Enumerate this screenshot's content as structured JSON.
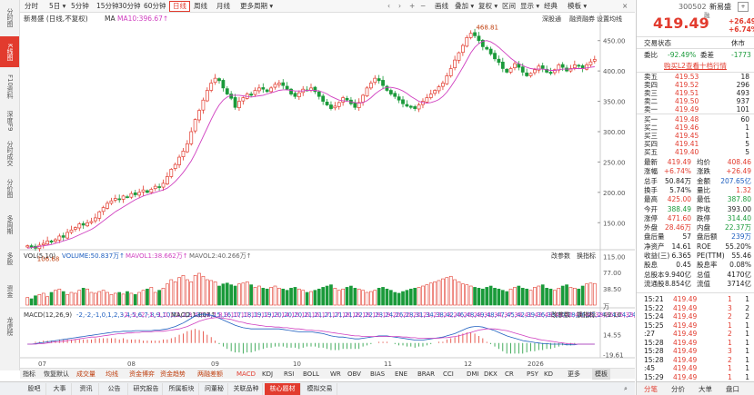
{
  "left_nav": [
    {
      "label": "分时图",
      "active": false
    },
    {
      "label": "K线图",
      "active": true
    },
    {
      "label": "F10资料",
      "active": false
    },
    {
      "label": "深度F9",
      "active": false
    },
    {
      "label": "分时成交",
      "active": false
    },
    {
      "label": "分价图",
      "active": false
    },
    {
      "label": "多周期",
      "active": false
    },
    {
      "label": "多股",
      "active": false
    },
    {
      "label": "资金",
      "active": false
    },
    {
      "label": "龙虎榜",
      "active": false
    }
  ],
  "toolbar": {
    "items": [
      {
        "label": "分时",
        "active": false
      },
      {
        "label": "5日 ▾",
        "active": false
      },
      {
        "label": "5分钟",
        "active": false
      },
      {
        "label": "15分钟",
        "active": false
      },
      {
        "label": "30分钟",
        "active": false
      },
      {
        "label": "60分钟",
        "active": false
      },
      {
        "label": "日线",
        "active": true
      },
      {
        "label": "周线",
        "active": false
      },
      {
        "label": "月线",
        "active": false
      },
      {
        "label": "更多周期 ▾",
        "active": false
      }
    ],
    "right_items": [
      "画线",
      "叠加 ▾",
      "复权 ▾",
      "区间",
      "显示 ▾",
      "经典",
      "模板 ▾"
    ]
  },
  "chart_header": {
    "title": "新易盛 (日线,不复权)",
    "ma_label": "MA",
    "ma10": "MA10:396.67↑",
    "links": [
      "深股通",
      "融资融券",
      "设置均线"
    ]
  },
  "chart_data": [
    {
      "type": "candlestick",
      "title": "新易盛 (日线,不复权)",
      "y_ticks": [
        "450.00",
        "400.00",
        "350.00",
        "300.00",
        "250.00",
        "200.00",
        "150.00"
      ],
      "y_range": [
        110,
        478
      ],
      "x_ticks": [
        "07",
        "08",
        "09",
        "10",
        "11",
        "12",
        "2026"
      ],
      "annotations": [
        {
          "label": "468.81",
          "type": "high"
        },
        {
          "label": "106.68",
          "type": "low"
        }
      ],
      "ma10_label": "MA10:396.67↑",
      "closes": [
        112,
        110,
        108,
        113,
        116,
        120,
        118,
        122,
        128,
        126,
        134,
        138,
        142,
        148,
        146,
        150,
        152,
        158,
        168,
        175,
        182,
        186,
        190,
        188,
        194,
        192,
        198,
        196,
        200,
        204,
        200,
        205,
        210,
        208,
        215,
        226,
        238,
        246,
        258,
        268,
        280,
        300,
        320,
        335,
        352,
        368,
        380,
        388,
        384,
        372,
        362,
        355,
        340,
        350,
        356,
        362,
        360,
        368,
        372,
        370,
        366,
        372,
        378,
        380,
        376,
        370,
        362,
        358,
        364,
        370,
        368,
        372,
        366,
        358,
        350,
        344,
        338,
        342,
        348,
        356,
        352,
        346,
        340,
        348,
        360,
        372,
        380,
        388,
        384,
        376,
        368,
        362,
        358,
        352,
        346,
        342,
        340,
        338,
        344,
        350,
        356,
        362,
        368,
        374,
        380,
        392,
        404,
        418,
        430,
        442,
        455,
        462,
        458,
        450,
        440,
        436,
        428,
        420,
        414,
        404,
        398,
        404,
        412,
        406,
        398,
        392,
        396,
        402,
        408,
        404,
        398,
        396,
        402,
        410,
        406,
        400,
        404,
        410,
        408,
        404,
        410,
        415,
        419
      ],
      "ma10": [
        108,
        109,
        110,
        111,
        112,
        113,
        114,
        116,
        118,
        120,
        122,
        124,
        127,
        130,
        133,
        136,
        139,
        143,
        148,
        153,
        158,
        163,
        168,
        172,
        176,
        180,
        184,
        188,
        191,
        194,
        196,
        198,
        200,
        202,
        204,
        207,
        212,
        218,
        225,
        233,
        242,
        252,
        264,
        278,
        292,
        306,
        320,
        333,
        344,
        352,
        357,
        360,
        360,
        360,
        359,
        358,
        357,
        358,
        359,
        360,
        362,
        364,
        366,
        368,
        369,
        369,
        368,
        367,
        367,
        367,
        368,
        368,
        368,
        367,
        365,
        362,
        358,
        355,
        352,
        351,
        350,
        349,
        348,
        347,
        348,
        351,
        356,
        362,
        367,
        371,
        373,
        373,
        372,
        370,
        367,
        363,
        358,
        354,
        350,
        348,
        347,
        348,
        350,
        353,
        358,
        365,
        374,
        384,
        395,
        406,
        418,
        430,
        439,
        445,
        449,
        450,
        448,
        444,
        439,
        433,
        427,
        421,
        416,
        412,
        409,
        406,
        404,
        403,
        403,
        403,
        402,
        401,
        401,
        402,
        403,
        403,
        403,
        404,
        404,
        404,
        405,
        406,
        407
      ],
      "volume": {
        "label": "VOL(5,10)",
        "volume": "VOLUME:50.837万↑",
        "mavol1": "MAVOL1:38.662万↑",
        "mavol2": "MAVOL2:40.266万↑",
        "y_ticks": [
          "115.00",
          "77.00",
          "38.50"
        ],
        "y_range": [
          0,
          120
        ],
        "values": [
          18,
          15,
          22,
          25,
          28,
          20,
          30,
          35,
          38,
          32,
          25,
          30,
          28,
          35,
          40,
          38,
          30,
          28,
          32,
          35,
          30,
          25,
          28,
          30,
          26,
          32,
          28,
          25,
          30,
          35,
          38,
          42,
          30,
          35,
          40,
          50,
          60,
          55,
          65,
          70,
          60,
          55,
          70,
          75,
          68,
          60,
          58,
          55,
          45,
          50,
          52,
          48,
          45,
          50,
          52,
          55,
          48,
          42,
          45,
          40,
          38,
          42,
          45,
          40,
          38,
          35,
          40,
          42,
          38,
          35,
          30,
          32,
          35,
          38,
          42,
          45,
          48,
          40,
          35,
          38,
          42,
          45,
          40,
          38,
          35,
          30,
          32,
          35,
          40,
          42,
          38,
          35,
          30,
          28,
          32,
          35,
          38,
          40,
          42,
          45,
          48,
          52,
          55,
          58,
          62,
          65,
          68,
          60,
          55,
          50,
          48,
          45,
          42,
          40,
          38,
          42,
          45,
          40,
          38,
          35,
          32,
          38,
          42,
          45,
          40,
          38,
          35,
          42,
          45,
          48,
          40,
          38,
          35,
          40,
          45,
          48,
          42,
          40,
          38,
          45,
          50,
          52,
          51
        ]
      },
      "macd": {
        "label": "MACD(12,26,9)",
        "dif": [
          -2,
          -2,
          -1,
          0,
          1,
          2,
          3,
          4,
          5,
          6,
          7,
          8,
          9,
          10,
          11,
          12,
          13,
          14,
          15,
          16,
          17,
          18,
          19,
          19,
          20,
          20,
          20,
          21,
          21,
          21,
          21,
          21,
          22,
          22,
          23,
          24,
          26,
          28,
          31,
          34,
          38,
          42,
          46,
          48,
          49,
          48,
          47,
          45,
          42,
          39,
          36,
          33,
          30,
          28,
          26,
          25,
          24,
          24,
          24,
          24,
          24,
          24,
          24,
          24,
          23,
          22,
          21,
          20,
          19,
          19,
          19,
          19,
          18,
          17,
          16,
          14,
          12,
          11,
          10,
          10,
          9,
          8,
          7,
          7,
          8,
          9,
          10,
          11,
          12,
          12,
          12,
          11,
          10,
          9,
          8,
          7,
          6,
          5,
          5,
          5,
          6,
          7,
          8,
          9,
          10,
          12,
          14,
          16,
          19,
          22,
          25,
          27,
          28,
          28,
          27,
          25,
          23,
          21,
          18,
          15,
          12,
          10,
          8,
          6,
          4,
          3,
          2,
          1,
          0,
          -1,
          -1,
          -2,
          -2,
          -2,
          -2,
          -3,
          -3,
          -3,
          -2,
          -2,
          -2,
          -2,
          -2
        ],
        "dea": [
          -2,
          -2,
          -2,
          -1,
          -1,
          0,
          1,
          2,
          2,
          3,
          4,
          5,
          6,
          7,
          8,
          9,
          10,
          10,
          11,
          12,
          13,
          14,
          15,
          16,
          16,
          17,
          17,
          18,
          18,
          19,
          19,
          19,
          20,
          20,
          20,
          21,
          22,
          23,
          24,
          26,
          28,
          31,
          34,
          37,
          39,
          41,
          42,
          43,
          43,
          42,
          41,
          40,
          38,
          36,
          35,
          33,
          32,
          31,
          30,
          29,
          28,
          28,
          27,
          27,
          26,
          26,
          25,
          24,
          24,
          23,
          22,
          22,
          21,
          21,
          20,
          19,
          18,
          17,
          16,
          15,
          14,
          13,
          12,
          12,
          11,
          11,
          11,
          11,
          11,
          11,
          11,
          11,
          11,
          11,
          10,
          10,
          9,
          9,
          8,
          8,
          8,
          8,
          8,
          8,
          9,
          9,
          10,
          11,
          12,
          14,
          16,
          18,
          20,
          22,
          23,
          24,
          24,
          24,
          23,
          22,
          21,
          19,
          17,
          15,
          13,
          11,
          9,
          8,
          6,
          5,
          4,
          3,
          2,
          1,
          0,
          -1,
          -1,
          -2,
          -2,
          -2,
          -2,
          -2,
          -2
        ],
        "macd": "MACD:1.007↑",
        "y_ticks": [
          "49.16",
          "14.55",
          "-19.61"
        ],
        "y_range": [
          -22,
          52
        ]
      }
    }
  ],
  "bottom_tabs": [
    "指标",
    "恢复默认",
    "成交量",
    "均线",
    "资金博弈",
    "资金趋势",
    "两融差额",
    "MACD",
    "KDJ",
    "RSI",
    "BOLL",
    "WR",
    "OBV",
    "BIAS",
    "ENE",
    "BRAR",
    "CCI",
    "DMI",
    "DKX",
    "CR",
    "PSY",
    "KD",
    "更多",
    "模板"
  ],
  "footer_tabs": [
    {
      "label": "股吧",
      "active": false
    },
    {
      "label": "大事",
      "active": false
    },
    {
      "label": "资讯",
      "active": false
    },
    {
      "label": "公告",
      "active": false
    },
    {
      "label": "研究报告",
      "active": false
    },
    {
      "label": "所属板块",
      "active": false
    },
    {
      "label": "问董秘",
      "active": false
    },
    {
      "label": "关联品种",
      "active": false
    },
    {
      "label": "核心题材",
      "active": true
    },
    {
      "label": "模拟交易",
      "active": false
    }
  ],
  "quote": {
    "code": "300502",
    "name": "新易盛",
    "badge": "融",
    "price": "419.49",
    "change": "+26.49",
    "change_pct": "+6.74%",
    "status_label": "交易状态",
    "status": "休市",
    "weibi_label": "委比",
    "weibi": "-92.49%",
    "weicha_label": "委差",
    "weicha": "-1773",
    "promo": "购买L2查看十档行情",
    "sell": [
      {
        "label": "卖五",
        "price": "419.53",
        "vol": "18"
      },
      {
        "label": "卖四",
        "price": "419.52",
        "vol": "296"
      },
      {
        "label": "卖三",
        "price": "419.51",
        "vol": "493"
      },
      {
        "label": "卖二",
        "price": "419.50",
        "vol": "937"
      },
      {
        "label": "卖一",
        "price": "419.49",
        "vol": "101"
      }
    ],
    "buy": [
      {
        "label": "买一",
        "price": "419.48",
        "vol": "60"
      },
      {
        "label": "买二",
        "price": "419.46",
        "vol": "1"
      },
      {
        "label": "买三",
        "price": "419.45",
        "vol": "1"
      },
      {
        "label": "买四",
        "price": "419.41",
        "vol": "5"
      },
      {
        "label": "买五",
        "price": "419.40",
        "vol": "5"
      }
    ],
    "stats": [
      {
        "l1": "最新",
        "v1": "419.49",
        "c1": "red",
        "l2": "均价",
        "v2": "408.46",
        "c2": "red"
      },
      {
        "l1": "涨幅",
        "v1": "+6.74%",
        "c1": "red",
        "l2": "涨跌",
        "v2": "+26.49",
        "c2": "red"
      },
      {
        "l1": "总手",
        "v1": "50.84万",
        "c1": "dark",
        "l2": "金额",
        "v2": "207.65亿",
        "c2": "blue"
      },
      {
        "l1": "换手",
        "v1": "5.74%",
        "c1": "dark",
        "l2": "量比",
        "v2": "1.32",
        "c2": "red"
      },
      {
        "l1": "最高",
        "v1": "425.00",
        "c1": "red",
        "l2": "最低",
        "v2": "387.80",
        "c2": "green"
      },
      {
        "l1": "今开",
        "v1": "388.49",
        "c1": "green",
        "l2": "昨收",
        "v2": "393.00",
        "c2": "dark"
      },
      {
        "l1": "涨停",
        "v1": "471.60",
        "c1": "red",
        "l2": "跌停",
        "v2": "314.40",
        "c2": "green"
      },
      {
        "l1": "外盘",
        "v1": "28.46万",
        "c1": "red",
        "l2": "内盘",
        "v2": "22.37万",
        "c2": "green"
      },
      {
        "l1": "盘后量",
        "v1": "57",
        "c1": "dark",
        "l2": "盘后额",
        "v2": "239万",
        "c2": "blue"
      },
      {
        "l1": "净资产",
        "v1": "14.61",
        "c1": "dark",
        "l2": "ROE",
        "v2": "55.20%",
        "c2": "dark"
      },
      {
        "l1": "收益(三)",
        "v1": "6.365",
        "c1": "dark",
        "l2": "PE(TTM)",
        "v2": "55.46",
        "c2": "dark"
      },
      {
        "l1": "股息",
        "v1": "0.45",
        "c1": "dark",
        "l2": "股息率",
        "v2": "0.08%",
        "c2": "dark"
      },
      {
        "l1": "总股本",
        "v1": "9.940亿",
        "c1": "dark",
        "l2": "总值",
        "v2": "4170亿",
        "c2": "dark"
      },
      {
        "l1": "流通股",
        "v1": "8.854亿",
        "c1": "dark",
        "l2": "流值",
        "v2": "3714亿",
        "c2": "dark"
      }
    ],
    "ticks": [
      {
        "time": "15:21",
        "price": "419.49",
        "vol": "1",
        "n": "1"
      },
      {
        "time": "15:22",
        "price": "419.49",
        "vol": "3",
        "n": "2"
      },
      {
        "time": "15:24",
        "price": "419.49",
        "vol": "2",
        "n": "2"
      },
      {
        "time": "15:25",
        "price": "419.49",
        "vol": "1",
        "n": "1"
      },
      {
        "time": ":27",
        "price": "419.49",
        "vol": "2",
        "n": "1"
      },
      {
        "time": "15:28",
        "price": "419.49",
        "vol": "1",
        "n": "1"
      },
      {
        "time": "15:28",
        "price": "419.49",
        "vol": "3",
        "n": "1"
      },
      {
        "time": "15:28",
        "price": "419.49",
        "vol": "2",
        "n": "1"
      },
      {
        "time": ":45",
        "price": "419.49",
        "vol": "1",
        "n": "1"
      },
      {
        "time": "15:29",
        "price": "419.49",
        "vol": "1",
        "n": "1"
      }
    ],
    "tabs": [
      "分笔",
      "分价",
      "大单",
      "盘口"
    ]
  }
}
